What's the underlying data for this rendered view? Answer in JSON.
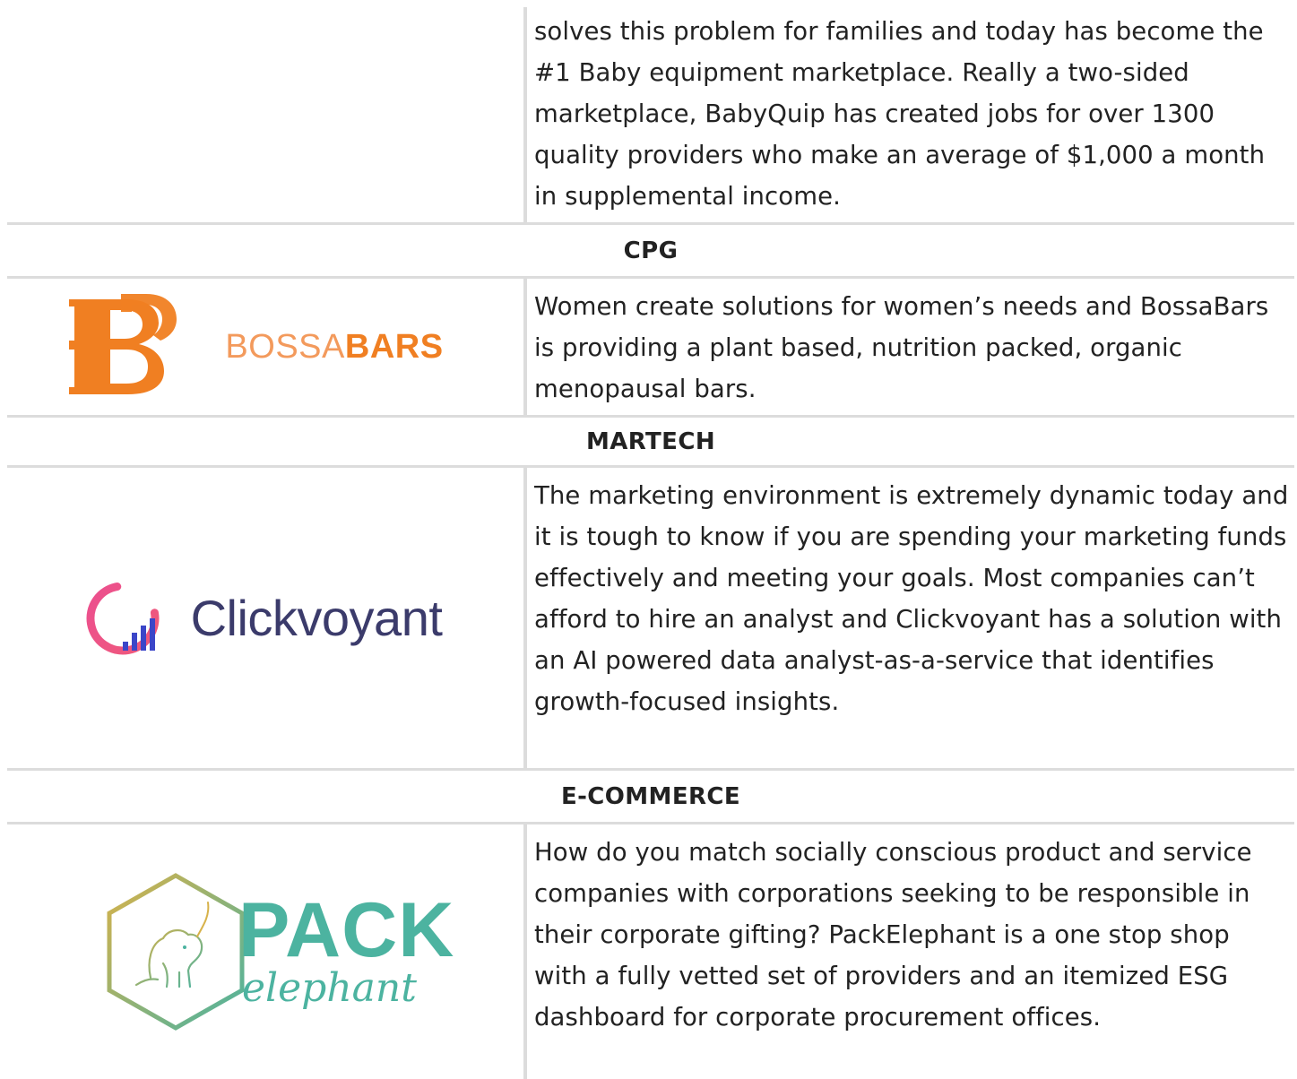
{
  "rows": [
    {
      "kind": "company",
      "logo": "none",
      "description": "solves this problem for families and today has become the #1 Baby equipment marketplace. Really a two-sided marketplace, BabyQuip has created jobs for over 1300 quality providers who make an average of $1,000 a month in supplemental income."
    },
    {
      "kind": "category",
      "label": "CPG"
    },
    {
      "kind": "company",
      "logo": "bossabars",
      "logo_text_light": "BOSSA",
      "logo_text_bold": "BARS",
      "description": "Women create solutions for women’s needs and BossaBars is providing a plant based, nutrition packed, organic menopausal bars."
    },
    {
      "kind": "category",
      "label": "MARTECH"
    },
    {
      "kind": "company",
      "logo": "clickvoyant",
      "logo_text": "Clickvoyant",
      "description": "The marketing environment is extremely dynamic today and it is tough to know if you are spending your marketing funds effectively and meeting your goals. Most companies can’t afford to hire an analyst and Clickvoyant has a solution with an AI powered data analyst-as-a-service that identifies growth-focused insights."
    },
    {
      "kind": "category",
      "label": "E-COMMERCE"
    },
    {
      "kind": "company",
      "logo": "packelephant",
      "logo_text_main": "PACK",
      "logo_text_script": "elephant",
      "description": "How do you match socially conscious product and service companies with corporations seeking to be responsible in their corporate gifting? PackElephant is a one stop shop with a fully vetted set of providers and an itemized ESG dashboard for corporate procurement offices."
    }
  ],
  "colors": {
    "border": "#dcdcdc",
    "text": "#222222",
    "bossa_orange": "#f07f22",
    "clickvoyant_pink": "#ec4f8f",
    "clickvoyant_blue": "#3b46c8",
    "clickvoyant_text": "#3b3b6b",
    "pack_teal": "#4cb3a0",
    "pack_gold": "#d7b24a"
  }
}
